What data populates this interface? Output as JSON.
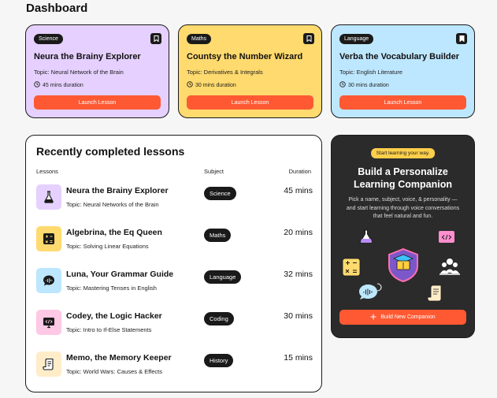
{
  "page": {
    "title": "Dashboard"
  },
  "cards": [
    {
      "subject": "Science",
      "name": "Neura the Brainy Explorer",
      "topic": "Topic: Neural Network of the Brain",
      "duration": "45 mins duration",
      "button": "Launch Lesson",
      "color": "#e5d0ff"
    },
    {
      "subject": "Maths",
      "name": "Countsy the Number Wizard",
      "topic": "Topic: Derivatives & Integrals",
      "duration": "30 mins duration",
      "button": "Launch Lesson",
      "color": "#ffda6e"
    },
    {
      "subject": "Language",
      "name": "Verba the Vocabulary Builder",
      "topic": "Topic: English Literature",
      "duration": "30 mins duration",
      "button": "Launch Lesson",
      "color": "#bde7ff"
    }
  ],
  "recent": {
    "title": "Recently completed lessons",
    "columns": {
      "lessons": "Lessons",
      "subject": "Subject",
      "duration": "Duration"
    },
    "rows": [
      {
        "name": "Neura the Brainy Explorer",
        "topic": "Topic: Neural Networks of the Brain",
        "subject": "Science",
        "duration": "45 mins",
        "icon": "flask-icon",
        "color": "#e5d0ff"
      },
      {
        "name": "Algebrina, the Eq Queen",
        "topic": "Topic: Solving Linear Equations",
        "subject": "Maths",
        "duration": "20 mins",
        "icon": "calculator-icon",
        "color": "#ffda6e"
      },
      {
        "name": "Luna, Your Grammar Guide",
        "topic": "Topic: Mastering Tenses in English",
        "subject": "Language",
        "duration": "32 mins",
        "icon": "speech-bubble-icon",
        "color": "#bde7ff"
      },
      {
        "name": "Codey, the Logic Hacker",
        "topic": "Topic: Intro to If-Else Statements",
        "subject": "Coding",
        "duration": "30 mins",
        "icon": "code-monitor-icon",
        "color": "#ffc8e4"
      },
      {
        "name": "Memo, the Memory Keeper",
        "topic": "Topic: World Wars: Causes & Effects",
        "subject": "History",
        "duration": "15 mins",
        "icon": "scroll-icon",
        "color": "#ffecc8"
      }
    ]
  },
  "promo": {
    "badge": "Start learning your way.",
    "title": "Build a Personalize Learning Companion",
    "description": "Pick a name, subject, voice, & personality — and start learning through voice conversations that feel natural and fun.",
    "button": "Build New Companion"
  }
}
